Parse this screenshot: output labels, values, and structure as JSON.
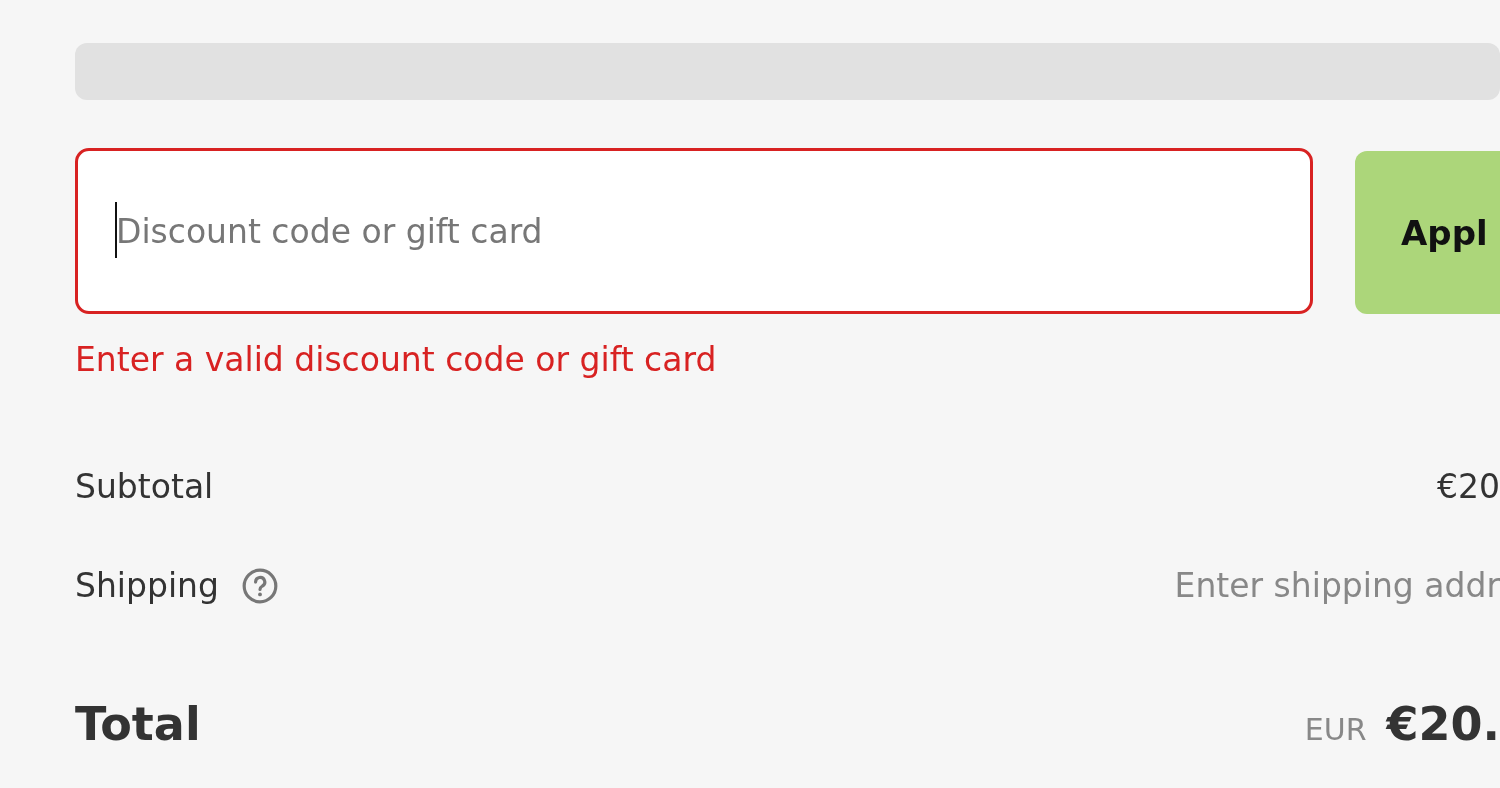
{
  "loading_bar": true,
  "discount": {
    "placeholder": "Discount code or gift card",
    "error": true,
    "focused": true,
    "error_message": "Enter a valid discount code or gift card",
    "button": "Appl"
  },
  "summary": [
    {
      "kind": "line",
      "label": "Subtotal",
      "value": "€20",
      "muted": false,
      "help": false
    },
    {
      "kind": "line",
      "label": "Shipping",
      "value": "Enter shipping addr",
      "muted": true,
      "help": true
    }
  ],
  "total": {
    "label": "Total",
    "currency": "EUR",
    "value": "€20."
  }
}
